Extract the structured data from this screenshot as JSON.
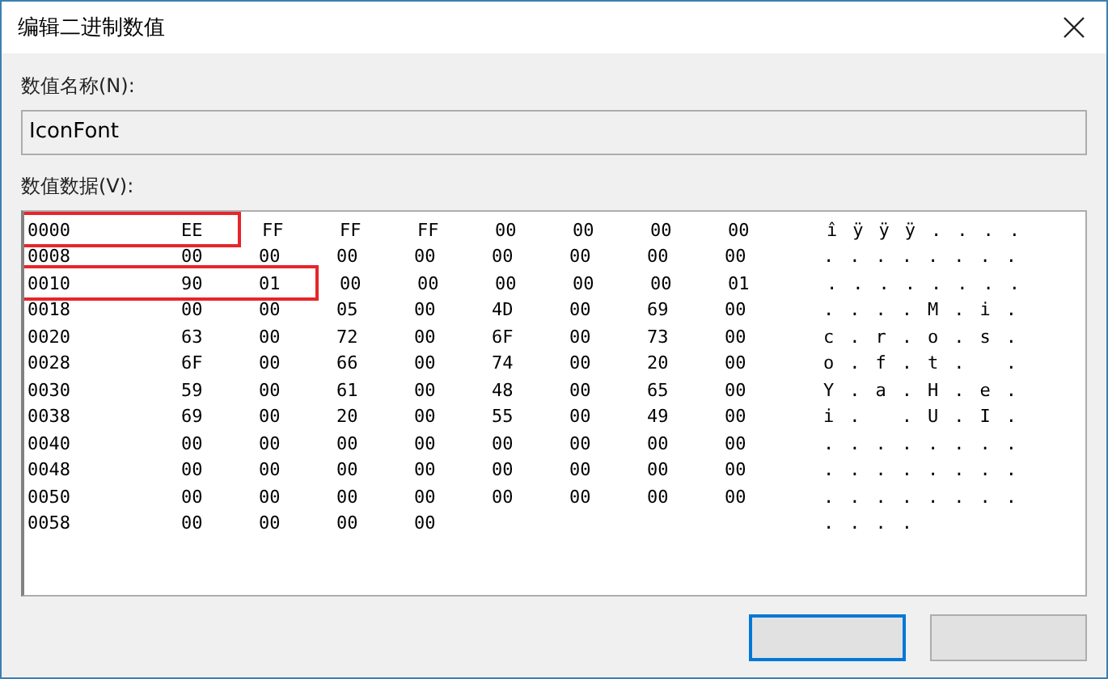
{
  "window": {
    "title": "编辑二进制数值"
  },
  "value_name": {
    "label": "数值名称(N):",
    "value": "IconFont"
  },
  "value_data": {
    "label": "数值数据(V):",
    "rows": [
      {
        "address": "0000",
        "boxed_bytes": [
          "EE"
        ],
        "bytes": [
          "FF",
          "FF",
          "FF",
          "00",
          "00",
          "00",
          "00"
        ],
        "ascii": "îÿÿÿ...."
      },
      {
        "address": "0008",
        "bytes": [
          "00",
          "00",
          "00",
          "00",
          "00",
          "00",
          "00",
          "00"
        ],
        "ascii": "........"
      },
      {
        "address": "0010",
        "boxed_bytes": [
          "90",
          "01"
        ],
        "bytes": [
          "00",
          "00",
          "00",
          "00",
          "00",
          "01"
        ],
        "ascii": "........"
      },
      {
        "address": "0018",
        "bytes": [
          "00",
          "00",
          "05",
          "00",
          "4D",
          "00",
          "69",
          "00"
        ],
        "ascii": "....M.i."
      },
      {
        "address": "0020",
        "bytes": [
          "63",
          "00",
          "72",
          "00",
          "6F",
          "00",
          "73",
          "00"
        ],
        "ascii": "c.r.o.s."
      },
      {
        "address": "0028",
        "bytes": [
          "6F",
          "00",
          "66",
          "00",
          "74",
          "00",
          "20",
          "00"
        ],
        "ascii": "o.f.t. ."
      },
      {
        "address": "0030",
        "bytes": [
          "59",
          "00",
          "61",
          "00",
          "48",
          "00",
          "65",
          "00"
        ],
        "ascii": "Y.a.H.e."
      },
      {
        "address": "0038",
        "bytes": [
          "69",
          "00",
          "20",
          "00",
          "55",
          "00",
          "49",
          "00"
        ],
        "ascii": "i. .U.I."
      },
      {
        "address": "0040",
        "bytes": [
          "00",
          "00",
          "00",
          "00",
          "00",
          "00",
          "00",
          "00"
        ],
        "ascii": "........"
      },
      {
        "address": "0048",
        "bytes": [
          "00",
          "00",
          "00",
          "00",
          "00",
          "00",
          "00",
          "00"
        ],
        "ascii": "........"
      },
      {
        "address": "0050",
        "bytes": [
          "00",
          "00",
          "00",
          "00",
          "00",
          "00",
          "00",
          "00"
        ],
        "ascii": "........"
      },
      {
        "address": "0058",
        "bytes": [
          "00",
          "00",
          "00",
          "00"
        ],
        "ascii": "...."
      }
    ]
  },
  "buttons": [
    {
      "default": true
    },
    {
      "default": false
    }
  ]
}
